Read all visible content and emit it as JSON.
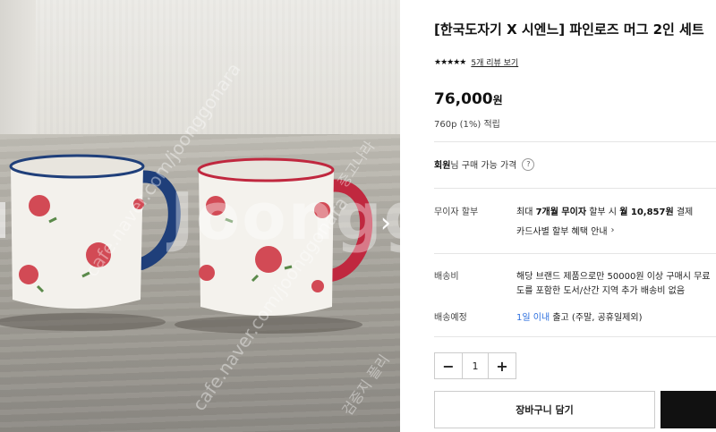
{
  "product": {
    "title": "[한국도자기 X 시엔느] 파인로즈 머그 2인 세트",
    "rating_stars": "★★★★★",
    "review_link": "5개 리뷰 보기",
    "price": "76,000",
    "price_unit": "원",
    "points": "760p (1%) 적립"
  },
  "member_price": {
    "bold": "회원",
    "text": "님 구매 가능 가격",
    "help": "?"
  },
  "installment": {
    "label": "무이자 할부",
    "line_prefix": "최대 ",
    "line_bold1": "7개월 무이자",
    "line_mid": " 할부 시 ",
    "line_bold2": "월 10,857원",
    "line_suffix": " 결제",
    "card_link": "카드사별 할부 혜택 안내"
  },
  "shipping": {
    "label": "배송비",
    "line1": "해당 브랜드 제품으로만 50000원 이상 구매시 무료",
    "line2": "도를 포함한 도서/산간 지역 추가 배송비 없음"
  },
  "delivery": {
    "label": "배송예정",
    "highlight": "1일 이내",
    "text": " 출고 (주말, 공휴일제외)"
  },
  "quantity": {
    "minus": "−",
    "value": "1",
    "plus": "+"
  },
  "buttons": {
    "cart": "장바구니 담기"
  },
  "image": {
    "watermark": "Joongg",
    "watermark_diag1": "cafe.naver.com/joonggonara",
    "watermark_diag2": "cafe.naver.com/joonggonara",
    "watermark_side1": "중고나라",
    "watermark_side2": "검증지 플리",
    "next": "›"
  },
  "colors": {
    "blue_rim": "#1f3f7a",
    "red_rim": "#c0283f",
    "rose": "#d24a55",
    "link_blue": "#2b6ede",
    "buy_black": "#111111"
  }
}
